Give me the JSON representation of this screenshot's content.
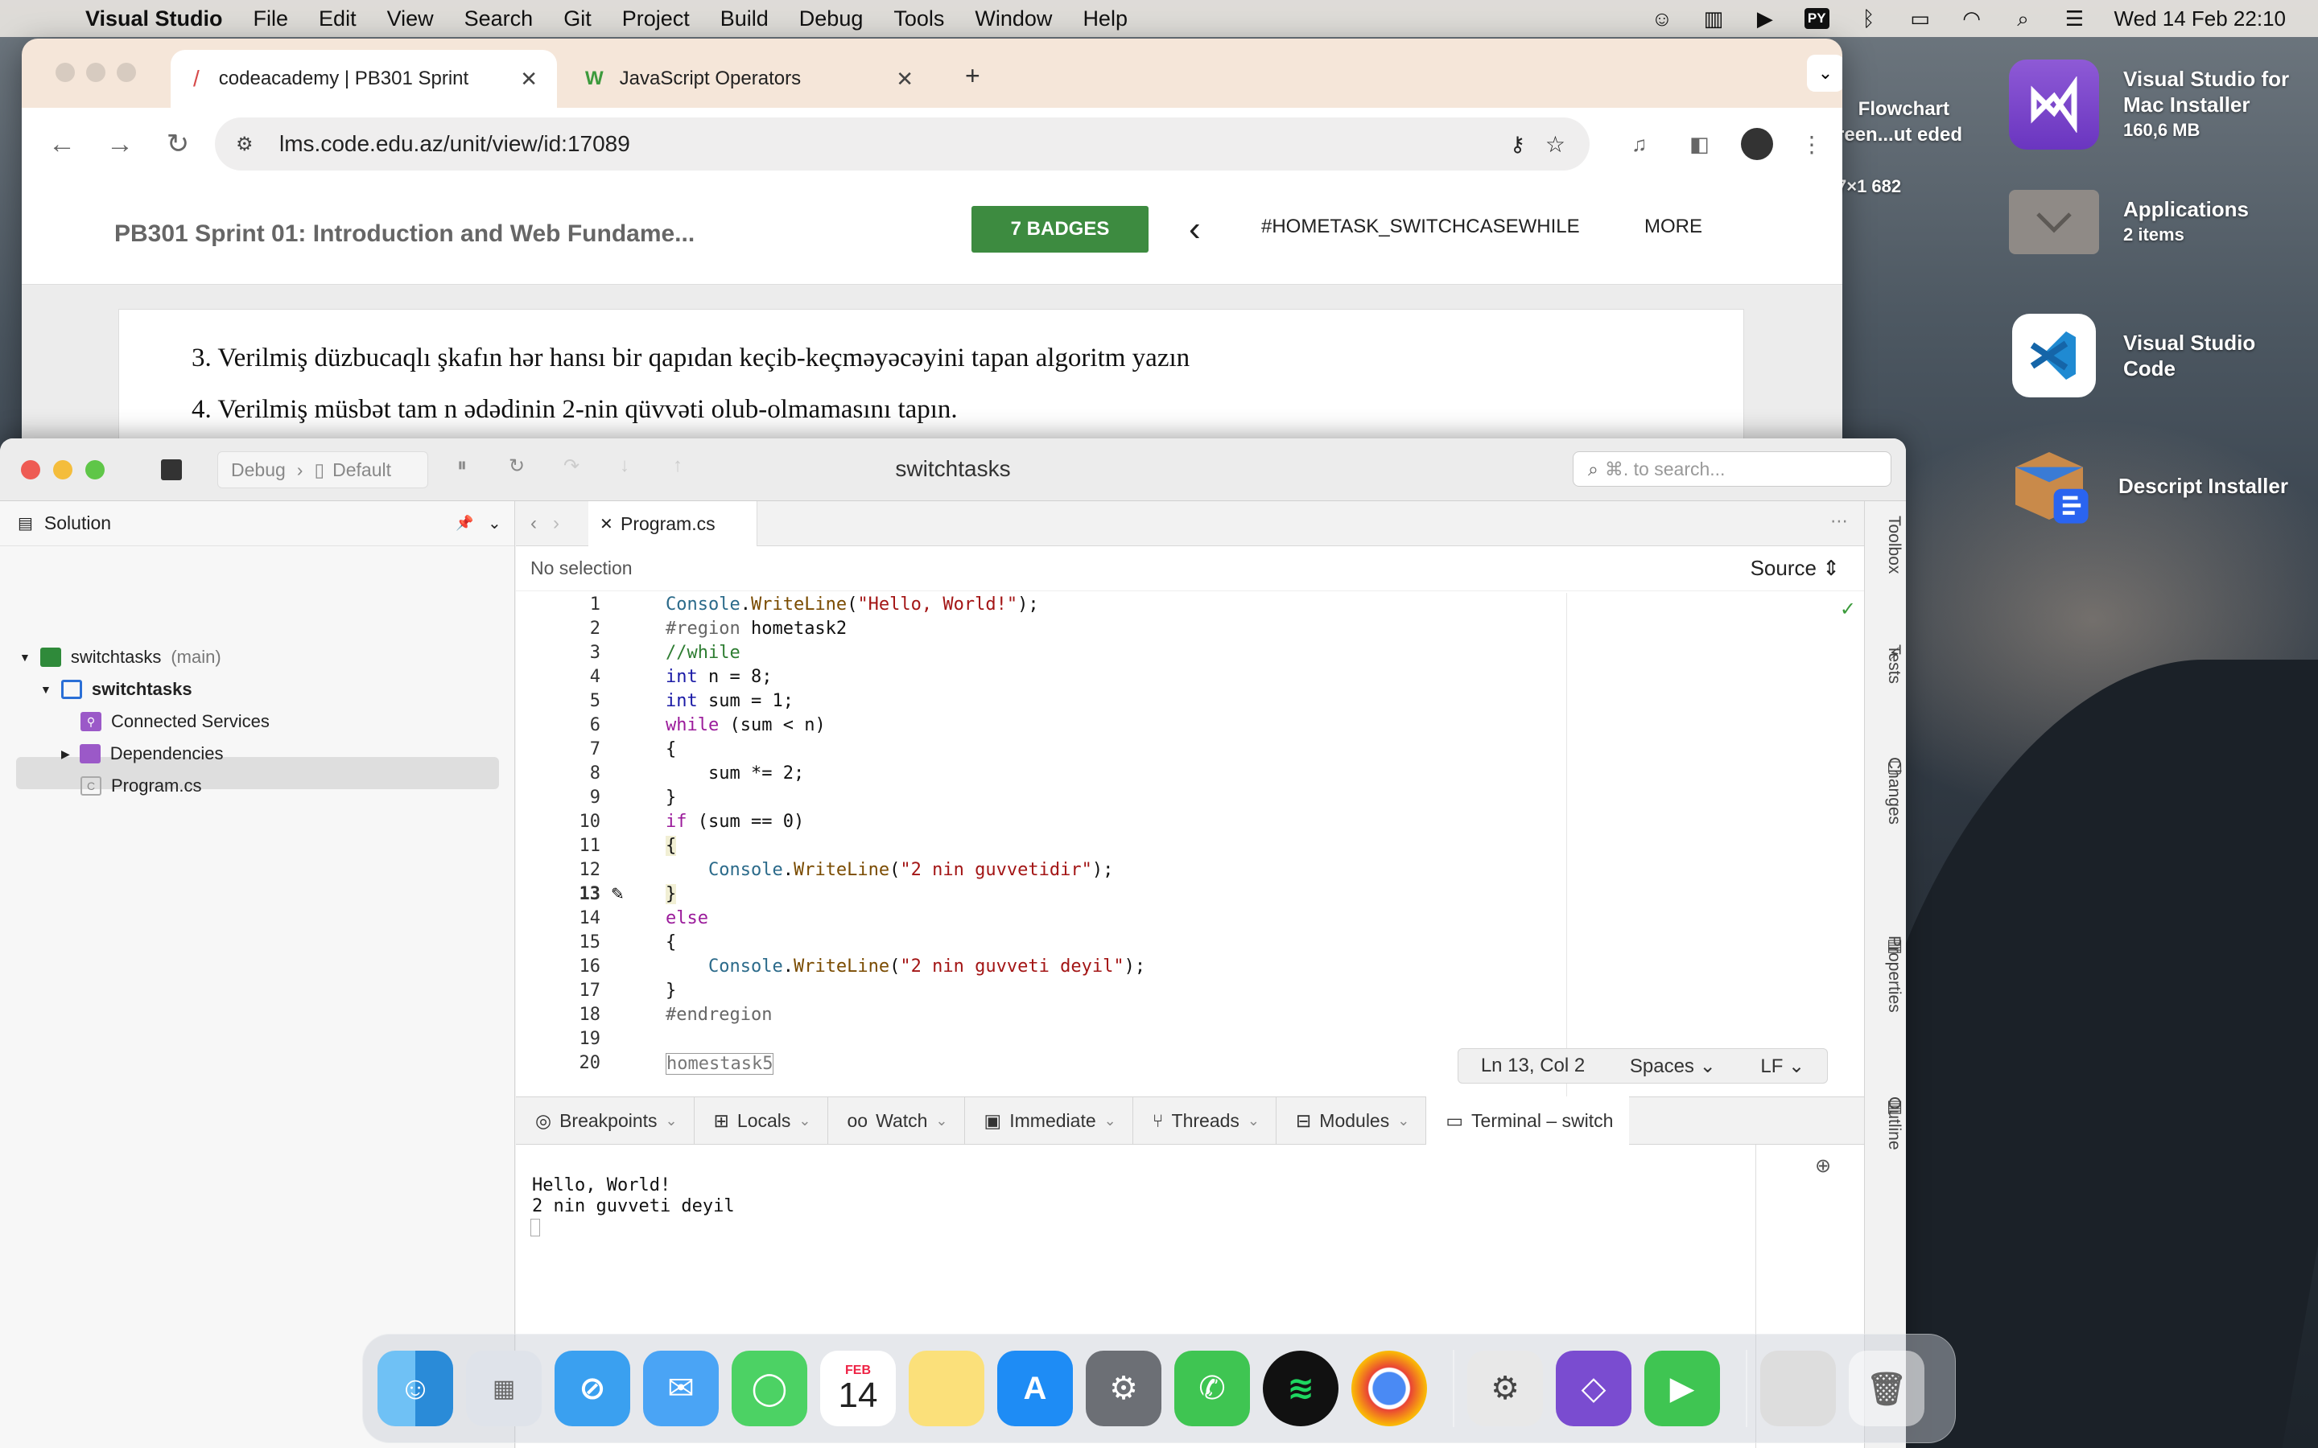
{
  "menubar": {
    "app": "Visual Studio",
    "items": [
      "File",
      "Edit",
      "View",
      "Search",
      "Git",
      "Project",
      "Build",
      "Debug",
      "Tools",
      "Window",
      "Help"
    ],
    "py_badge": "PY",
    "clock": "Wed 14 Feb  22:10"
  },
  "desktop": {
    "flowchart_name": "Flowchart\nreen...ut eded",
    "flowchart_sub": "7×1 682",
    "icons": [
      {
        "name": "Visual Studio for Mac Installer",
        "sub": "160,6 MB"
      },
      {
        "name": "Applications",
        "sub": "2 items"
      },
      {
        "name": "Visual Studio Code",
        "sub": ""
      },
      {
        "name": "Descript Installer",
        "sub": ""
      }
    ]
  },
  "browser": {
    "tabs": [
      {
        "title": "codeacademy | PB301 Sprint"
      },
      {
        "title": "JavaScript Operators"
      }
    ],
    "url": "lms.code.edu.az/unit/view/id:17089",
    "course_title": "PB301 Sprint 01: Introduction and Web Fundame...",
    "badges_btn": "7 BADGES",
    "unit_nav": "#HOMETASK_SWITCHCASEWHILE",
    "more": "MORE",
    "lines": [
      "3. Verilmiş düzbucaqlı şkafın hər hansı bir qapıdan keçib-keçməyəcəyini tapan algoritm yazın",
      "4. Verilmiş müsbət tam n ədədinin 2-nin qüvvəti olub-olmamasını tapın."
    ]
  },
  "vs": {
    "title": "switchtasks",
    "config": "Debug",
    "device": "Default",
    "search_placeholder": "⌘. to search...",
    "solution": {
      "header": "Solution",
      "root": "switchtasks",
      "root_suffix": "(main)",
      "project": "switchtasks",
      "items": [
        "Connected Services",
        "Dependencies",
        "Program.cs"
      ]
    },
    "editor": {
      "tab": "Program.cs",
      "breadcrumb": "No selection",
      "source": "Source",
      "line_numbers": [
        "1",
        "2",
        "3",
        "4",
        "5",
        "6",
        "7",
        "8",
        "9",
        "10",
        "11",
        "12",
        "13",
        "14",
        "15",
        "16",
        "17",
        "18",
        "19",
        "20"
      ],
      "status_pos": "Ln 13, Col 2",
      "status_indent": "Spaces",
      "status_eol": "LF",
      "last_line": "homestask5"
    },
    "right_rail": [
      "Toolbox",
      "Tests",
      "Git Changes",
      "Properties",
      "Document Outline"
    ],
    "pads": [
      "Breakpoints",
      "Locals",
      "Watch",
      "Immediate",
      "Threads",
      "Modules",
      "Terminal – switch"
    ],
    "terminal_output": "Hello, World!\n2 nin guvveti deyil"
  },
  "dock": {
    "calendar_month": "FEB",
    "calendar_day": "14"
  },
  "colors": {
    "badge_green": "#3d8b40",
    "keyword": "#1a1aa6",
    "control_keyword": "#9b1b9b",
    "string": "#a31515",
    "comment": "#2e7d32"
  }
}
